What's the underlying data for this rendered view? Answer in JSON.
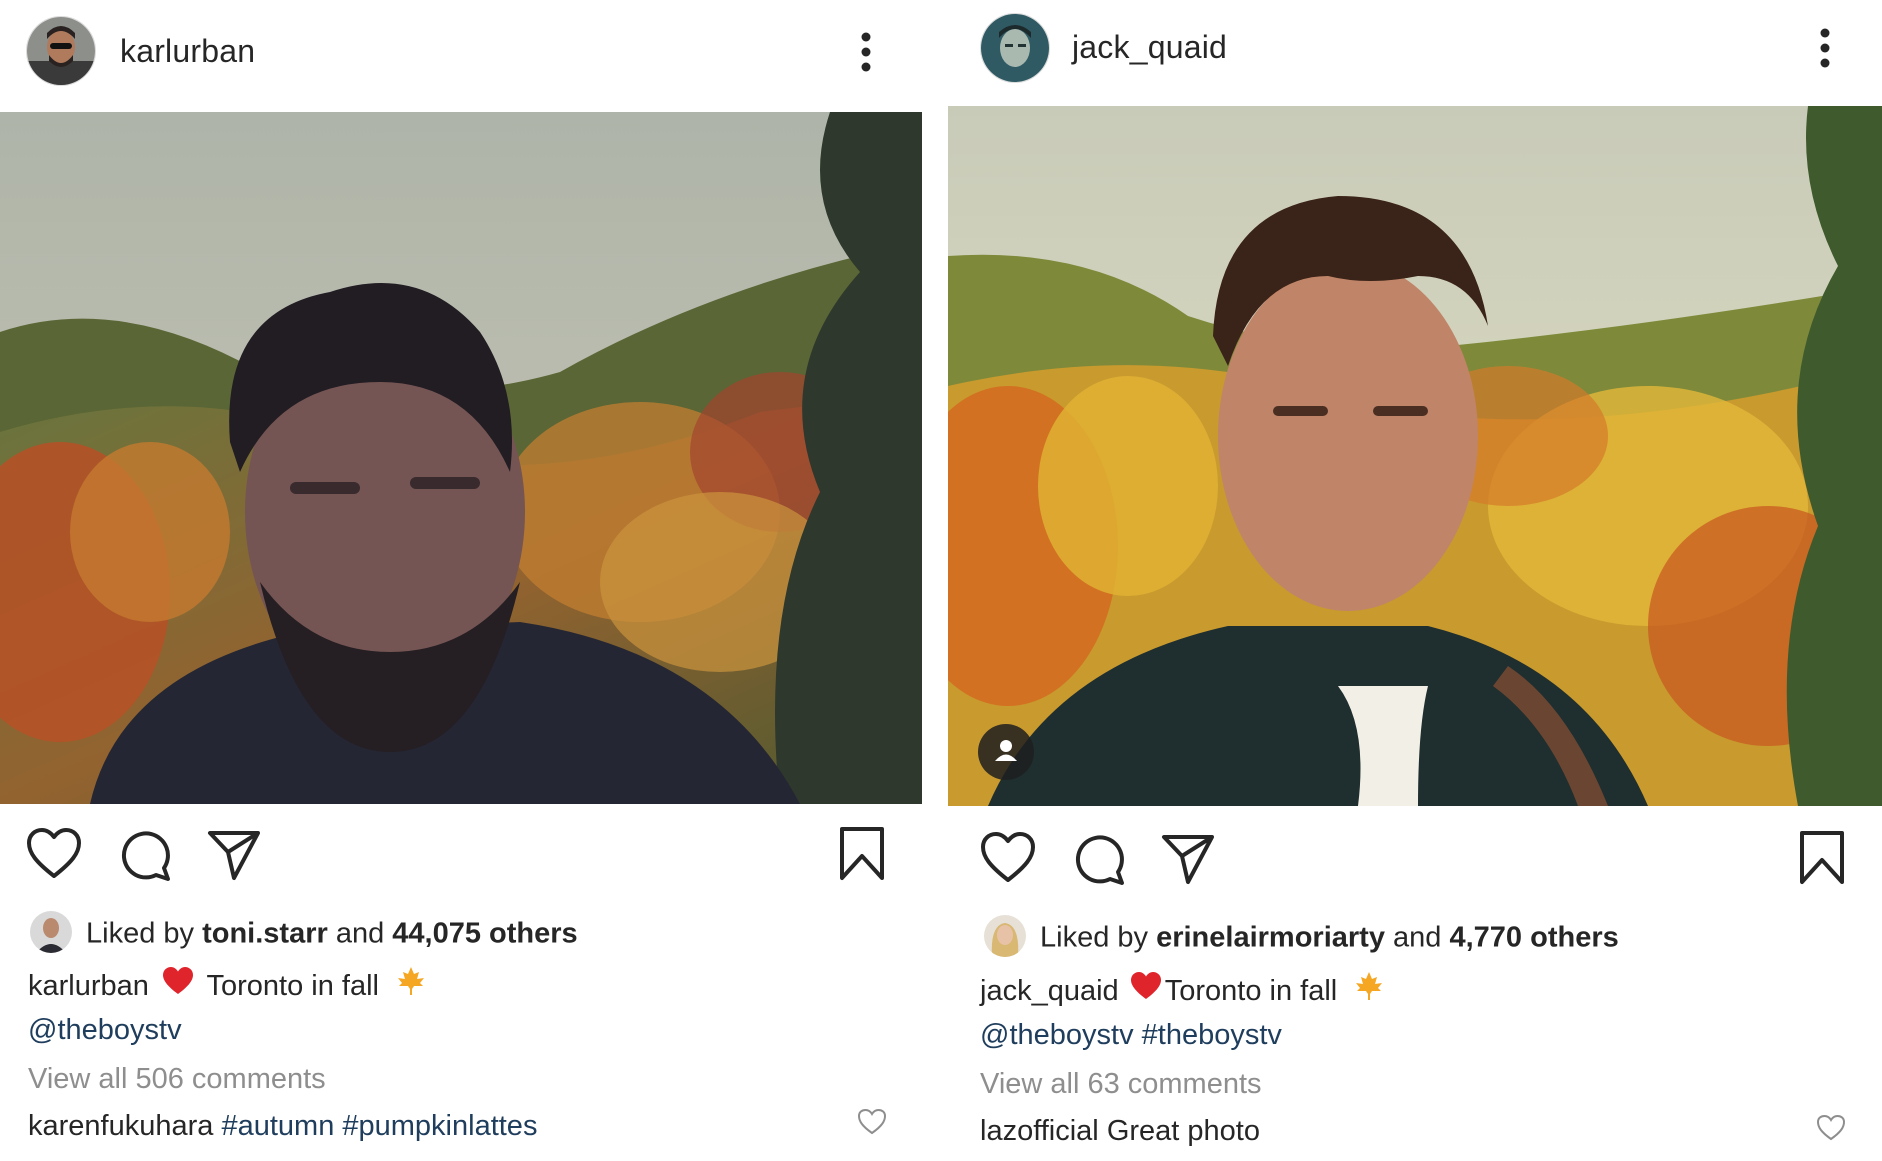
{
  "posts": [
    {
      "username": "karlurban",
      "liked_by_prefix": "Liked by",
      "liked_by_user": "toni.starr",
      "liked_and": "and",
      "liked_others": "44,075 others",
      "caption_user": "karlurban",
      "caption_emoji_heart": "❤️",
      "caption_text": "Toronto in fall",
      "caption_emoji_leaf": "🍁",
      "caption_tags": [
        "@theboystv"
      ],
      "view_comments": "View all 506 comments",
      "comment_user": "karenfukuhara",
      "comment_text": "#autumn #pumpkinlattes"
    },
    {
      "username": "jack_quaid",
      "liked_by_prefix": "Liked by",
      "liked_by_user": "erinelairmoriarty",
      "liked_and": "and",
      "liked_others": "4,770 others",
      "caption_user": "jack_quaid",
      "caption_emoji_heart": "❤️",
      "caption_text": "Toronto in fall",
      "caption_emoji_leaf": "🍁",
      "caption_tags": [
        "@theboystv",
        "#theboystv"
      ],
      "view_comments": "View all 63 comments",
      "comment_user": "lazofficial",
      "comment_text": "Great photo"
    }
  ],
  "icons": {
    "more": "more-options-icon",
    "like": "heart-icon",
    "comment": "comment-icon",
    "share": "send-icon",
    "save": "bookmark-icon",
    "tag": "user-tag-icon"
  },
  "colors": {
    "text": "#262626",
    "muted": "#8e8e8e",
    "link": "#1f3d5c",
    "heart_red": "#e0242c",
    "leaf_orange": "#f5a623"
  }
}
